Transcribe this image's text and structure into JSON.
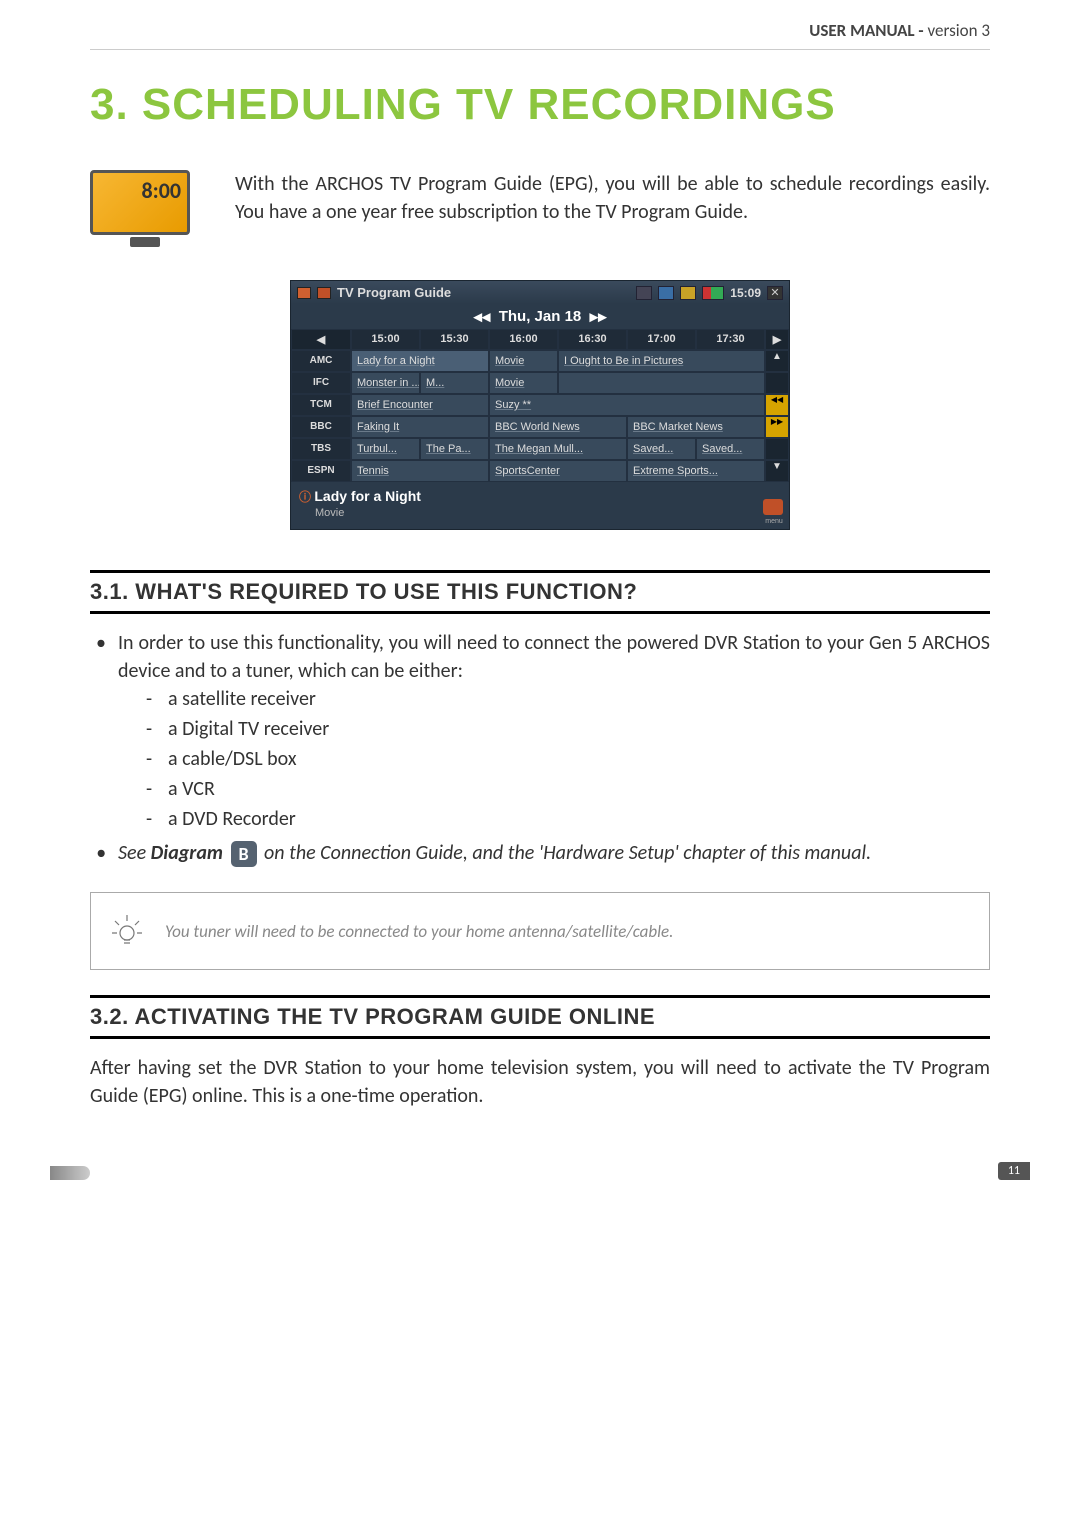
{
  "header": {
    "label": "USER MANUAL - ",
    "version": "version 3"
  },
  "title": "3. Scheduling TV recordings",
  "tv_icon_time": "8:00",
  "intro": "With the ARCHOS TV Program Guide (EPG), you will be able to schedule recordings easily. You have a one year free subscription to the TV Program Guide.",
  "epg": {
    "title": "TV Program Guide",
    "time": "15:09",
    "date": "Thu, Jan 18",
    "times": [
      "15:00",
      "15:30",
      "16:00",
      "16:30",
      "17:00",
      "17:30"
    ],
    "channels": [
      "AMC",
      "IFC",
      "TCM",
      "BBC",
      "TBS",
      "ESPN"
    ],
    "rows": [
      [
        {
          "t": "Lady for a Night",
          "span": 2
        },
        {
          "t": "Movie",
          "span": 1
        },
        {
          "t": "I Ought to Be in Pictures",
          "span": 3
        }
      ],
      [
        {
          "t": "Monster in ...",
          "span": 1
        },
        {
          "t": "M...",
          "span": 1
        },
        {
          "t": "Movie",
          "span": 1
        },
        {
          "t": "",
          "span": 3
        }
      ],
      [
        {
          "t": "Brief Encounter",
          "span": 2
        },
        {
          "t": "Suzy **",
          "span": 4
        }
      ],
      [
        {
          "t": "Faking It",
          "span": 2
        },
        {
          "t": "BBC World News",
          "span": 2
        },
        {
          "t": "BBC Market News",
          "span": 2
        }
      ],
      [
        {
          "t": "Turbul...",
          "span": 1
        },
        {
          "t": "The Pa...",
          "span": 1
        },
        {
          "t": "The Megan Mull...",
          "span": 2
        },
        {
          "t": "Saved...",
          "span": 1
        },
        {
          "t": "Saved...",
          "span": 1
        }
      ],
      [
        {
          "t": "Tennis",
          "span": 2
        },
        {
          "t": "SportsCenter",
          "span": 2
        },
        {
          "t": "Extreme Sports...",
          "span": 2
        }
      ]
    ],
    "selected": {
      "title": "Lady for a Night",
      "subtitle": "Movie"
    },
    "menu_label": "menu"
  },
  "sub1": {
    "heading": "3.1. What's required to use this function?",
    "bullet1": "In order to use this functionality, you will need to connect the powered DVR Station to your Gen 5 ARCHOS device and to a tuner, which can be either:",
    "subs": [
      "a satellite receiver",
      "a Digital TV receiver",
      "a cable/DSL box",
      "a VCR",
      "a DVD Recorder"
    ],
    "bullet2_pre": "See ",
    "bullet2_diagram_word": "Diagram",
    "bullet2_badge": "B",
    "bullet2_post": " on the Connection Guide, and the 'Hardware Setup' chapter of this manual."
  },
  "tip": "You tuner will need to be connected to your home antenna/satellite/cable.",
  "sub2": {
    "heading": "3.2. Activating the TV Program Guide online",
    "para": "After having set the DVR Station to your home television system, you will need to activate the TV Program Guide (EPG) online. This is a one-time operation."
  },
  "page_number": "11"
}
